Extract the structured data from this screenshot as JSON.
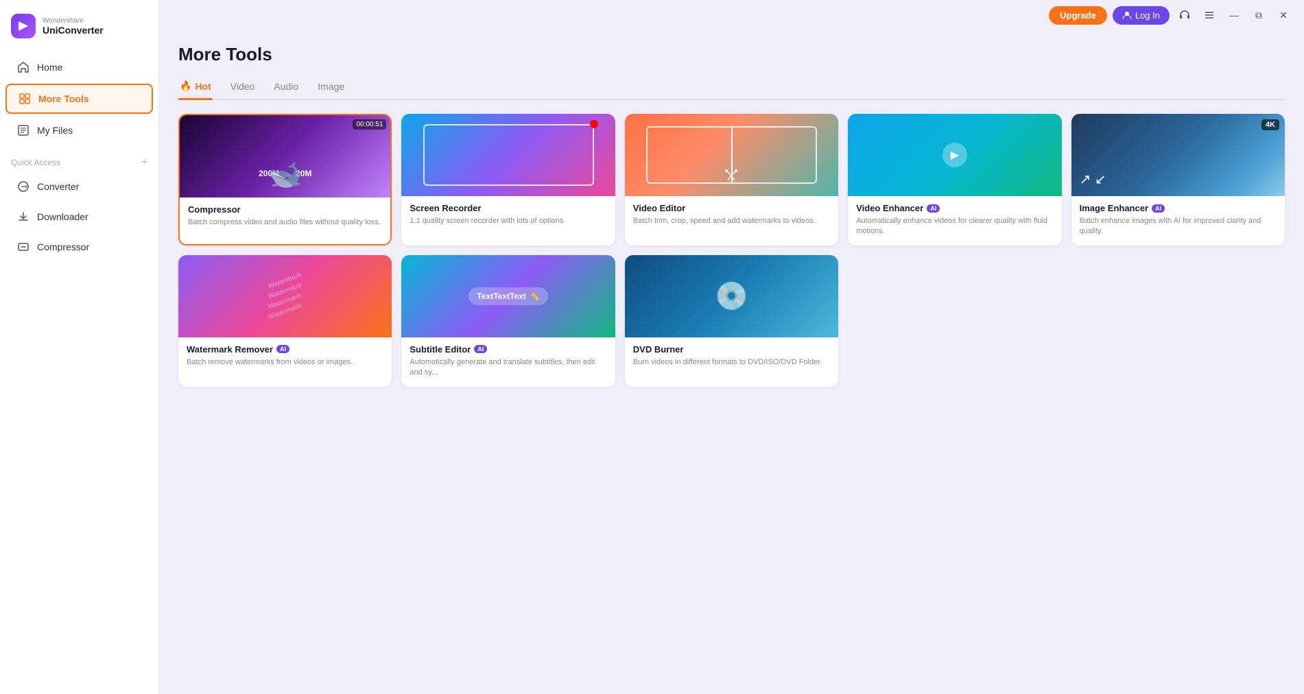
{
  "app": {
    "brand": "Wondershare",
    "name": "UniConverter"
  },
  "titlebar": {
    "upgrade_label": "Upgrade",
    "login_label": "Log In"
  },
  "sidebar": {
    "nav_items": [
      {
        "id": "home",
        "label": "Home",
        "icon": "home-icon",
        "active": false
      },
      {
        "id": "more-tools",
        "label": "More Tools",
        "icon": "grid-icon",
        "active": true
      },
      {
        "id": "my-files",
        "label": "My Files",
        "icon": "file-icon",
        "active": false
      }
    ],
    "section_label": "Quick Access",
    "sub_items": [
      {
        "id": "converter",
        "label": "Converter",
        "icon": "converter-icon"
      },
      {
        "id": "downloader",
        "label": "Downloader",
        "icon": "downloader-icon"
      },
      {
        "id": "compressor",
        "label": "Compressor",
        "icon": "compressor-icon"
      }
    ]
  },
  "main": {
    "page_title": "More Tools",
    "tabs": [
      {
        "id": "hot",
        "label": "Hot",
        "active": true,
        "has_fire": true
      },
      {
        "id": "video",
        "label": "Video",
        "active": false
      },
      {
        "id": "audio",
        "label": "Audio",
        "active": false
      },
      {
        "id": "image",
        "label": "Image",
        "active": false
      }
    ],
    "tools_row1": [
      {
        "id": "compressor",
        "title": "Compressor",
        "desc": "Batch compress video and audio files without quality loss.",
        "selected": true,
        "ai": false,
        "thumb_type": "compressor",
        "time_badge": "00:00:51",
        "compress_from": "200M",
        "compress_to": "20M"
      },
      {
        "id": "screen-recorder",
        "title": "Screen Recorder",
        "desc": "1:1 quality screen recorder with lots of options.",
        "selected": false,
        "ai": false,
        "thumb_type": "screen"
      },
      {
        "id": "video-editor",
        "title": "Video Editor",
        "desc": "Batch trim, crop, speed and add watermarks to videos.",
        "selected": false,
        "ai": false,
        "thumb_type": "video-editor"
      },
      {
        "id": "video-enhancer",
        "title": "Video Enhancer",
        "desc": "Automatically enhance videos for clearer quality with fluid motions.",
        "selected": false,
        "ai": true,
        "thumb_type": "video-enhancer"
      },
      {
        "id": "image-enhancer",
        "title": "Image Enhancer",
        "desc": "Batch enhance images with AI for improved clarity and quality.",
        "selected": false,
        "ai": true,
        "thumb_type": "image-enhancer"
      }
    ],
    "tools_row2": [
      {
        "id": "watermark-remover",
        "title": "Watermark Remover",
        "desc": "Batch remove watermarks from videos or images.",
        "selected": false,
        "ai": true,
        "thumb_type": "watermark"
      },
      {
        "id": "subtitle-editor",
        "title": "Subtitle Editor",
        "desc": "Automatically generate and translate subtitles, then edit and sy...",
        "selected": false,
        "ai": true,
        "thumb_type": "subtitle"
      },
      {
        "id": "dvd-burner",
        "title": "DVD Burner",
        "desc": "Burn videos in different formats to DVD/ISO/DVD Folder.",
        "selected": false,
        "ai": false,
        "thumb_type": "dvd"
      }
    ],
    "ai_label": "AI"
  }
}
